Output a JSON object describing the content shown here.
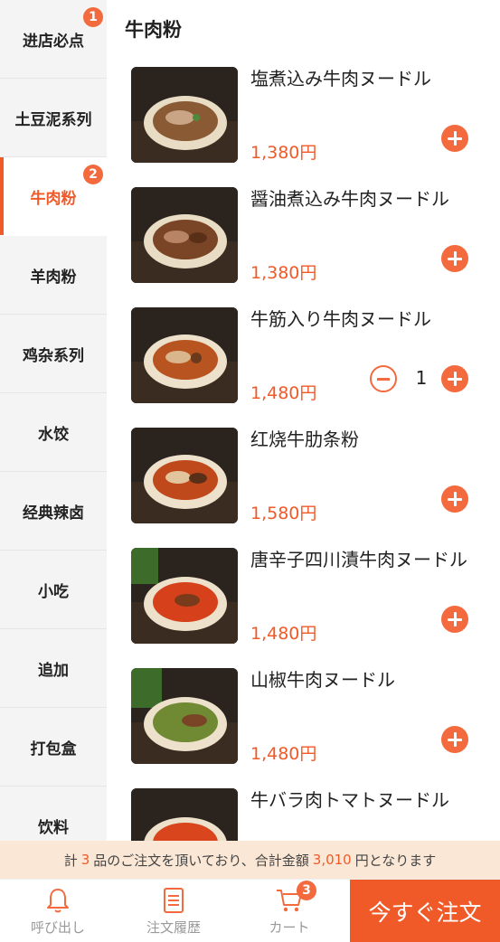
{
  "sidebar": {
    "items": [
      {
        "label": "进店必点",
        "badge": "1"
      },
      {
        "label": "土豆泥系列"
      },
      {
        "label": "牛肉粉",
        "badge": "2",
        "active": true
      },
      {
        "label": "羊肉粉"
      },
      {
        "label": "鸡杂系列"
      },
      {
        "label": "水饺"
      },
      {
        "label": "经典辣卤"
      },
      {
        "label": "小吃"
      },
      {
        "label": "追加"
      },
      {
        "label": "打包盒"
      },
      {
        "label": "饮料"
      }
    ]
  },
  "main": {
    "section_title": "牛肉粉",
    "products": [
      {
        "name": "塩煮込み牛肉ヌードル",
        "price": "1,380円",
        "icon": "plus-circle-icon"
      },
      {
        "name": "醤油煮込み牛肉ヌードル",
        "price": "1,380円",
        "icon": "plus-circle-icon"
      },
      {
        "name": "牛筋入り牛肉ヌードル",
        "price": "1,480円",
        "quantity": "1",
        "icon": "plus-circle-icon"
      },
      {
        "name": "红烧牛肋条粉",
        "price": "1,580円",
        "icon": "plus-circle-icon"
      },
      {
        "name": "唐辛子四川漬牛肉ヌードル",
        "price": "1,480円",
        "icon": "plus-circle-icon"
      },
      {
        "name": "山椒牛肉ヌードル",
        "price": "1,480円",
        "icon": "plus-circle-icon"
      },
      {
        "name": "牛バラ肉トマトヌードル",
        "price": "",
        "icon": "plus-circle-icon"
      }
    ]
  },
  "summary": {
    "prefix": "計",
    "count": "3",
    "middle": "品のご注文を頂いており、合計金額",
    "total": "3,010",
    "suffix": "円となります"
  },
  "bottom_bar": {
    "call_label": "呼び出し",
    "history_label": "注文履歴",
    "cart_label": "カート",
    "cart_count": "3",
    "order_label": "今すぐ注文"
  },
  "colors": {
    "accent": "#f05a28",
    "summary_bg": "#fbe7d5",
    "sidebar_bg": "#f4f4f4"
  }
}
